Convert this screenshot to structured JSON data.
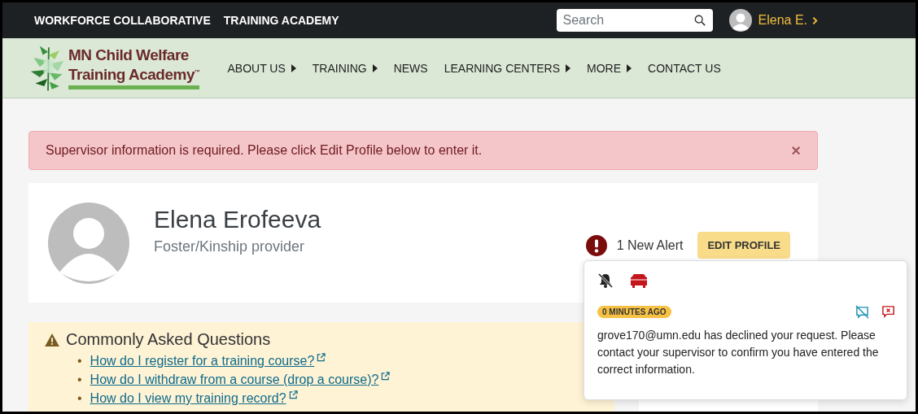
{
  "top_bar": {
    "links": [
      "WORKFORCE COLLABORATIVE",
      "TRAINING ACADEMY"
    ],
    "search": {
      "placeholder": "Search"
    },
    "user": {
      "name": "Elena E."
    }
  },
  "nav": {
    "logo": {
      "line_1": "MN Child Welfare",
      "line_2": "Training Academy",
      "mark": "™"
    },
    "items": [
      {
        "label": "ABOUT US",
        "has_submenu": true
      },
      {
        "label": "TRAINING",
        "has_submenu": true
      },
      {
        "label": "NEWS",
        "has_submenu": false
      },
      {
        "label": "LEARNING CENTERS",
        "has_submenu": true
      },
      {
        "label": "MORE",
        "has_submenu": true
      },
      {
        "label": "CONTACT US",
        "has_submenu": false
      }
    ]
  },
  "alert": {
    "message": "Supervisor information is required. Please click Edit Profile below to enter it.",
    "close": "×"
  },
  "profile": {
    "name": "Elena Erofeeva",
    "role": "Foster/Kinship provider",
    "alerts": "1 New Alert",
    "edit_button": "EDIT PROFILE"
  },
  "faq": {
    "title": "Commonly Asked Questions",
    "marker": "•",
    "links": [
      "How do I register for a training course?",
      "How do I withdraw from a course (drop a course)?",
      "How do I view my training record?"
    ]
  },
  "notification": {
    "time": "0 MINUTES AGO",
    "message": "grove170@umn.edu has declined your request. Please contact your supervisor to confirm you have entered the correct information."
  }
}
